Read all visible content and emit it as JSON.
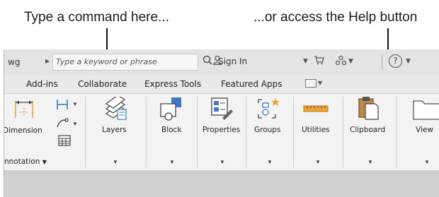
{
  "callouts": {
    "left": "Type a command here...",
    "right": "...or access the Help button"
  },
  "titlebar": {
    "filename": "wg",
    "search_placeholder": "Type a keyword or phrase",
    "sign_in": "Sign In"
  },
  "tabs": [
    "Add-ins",
    "Collaborate",
    "Express Tools",
    "Featured Apps"
  ],
  "ribbon": {
    "dimension_label": "Dimension",
    "annotation_label": "nnotation",
    "panels": [
      "Layers",
      "Block",
      "Properties",
      "Groups",
      "Utilities",
      "Clipboard",
      "View"
    ]
  },
  "colors": {
    "accent_orange": "#e8a33a",
    "accent_blue": "#3f79c1",
    "screenshot_bg": "#d3d3d3",
    "ribbon_bg": "#f3f3f3"
  }
}
